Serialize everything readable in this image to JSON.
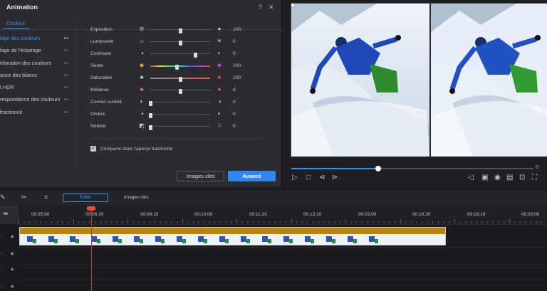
{
  "dialog": {
    "title": "Animation",
    "help_icon": "?",
    "close_icon": "✕",
    "tab": "Couleur",
    "left_items": [
      {
        "label": "lage des couleurs",
        "active": true
      },
      {
        "label": "lage de l'éclairage",
        "active": false
      },
      {
        "label": "élioration des couleurs",
        "active": false
      },
      {
        "label": "ance des blancs",
        "active": false
      },
      {
        "label": "t HDR",
        "active": false
      },
      {
        "label": "respondance des couleurs",
        "active": false
      },
      {
        "label": "fractionné",
        "active": false
      }
    ],
    "sliders": [
      {
        "label": "Exposition",
        "value": "100",
        "pos": 0.5
      },
      {
        "label": "Luminosité",
        "value": "0",
        "pos": 0.5
      },
      {
        "label": "Contraste",
        "value": "0",
        "pos": 0.75
      },
      {
        "label": "Teinte",
        "value": "100",
        "pos": 0.45
      },
      {
        "label": "Saturation",
        "value": "100",
        "pos": 0.5
      },
      {
        "label": "Brillance",
        "value": "0",
        "pos": 0.5
      },
      {
        "label": "Correct.surbrill.",
        "value": "0",
        "pos": 0.0
      },
      {
        "label": "Ombre",
        "value": "0",
        "pos": 0.0
      },
      {
        "label": "Netteté",
        "value": "0",
        "pos": 0.0
      }
    ],
    "compare_label": "Comparer dans l'aperçu fractionné",
    "compare_checked": true,
    "btn_keyframes": "Images clés",
    "btn_advanced": "Avancé"
  },
  "player": {
    "progress": 0.36,
    "time_tail": "0:"
  },
  "timeline": {
    "edit_label": "Éditer",
    "keys_label": "Images clés",
    "ticks": [
      "00;05;00",
      "00;06;20",
      "00;08;10",
      "00;10;00",
      "00;11;20",
      "00;13;10",
      "00;15;00",
      "00;16;20",
      "00;18;10",
      "00;20;00"
    ]
  },
  "colors": {
    "accent": "#2f86f0",
    "panel": "#2a2c31",
    "clip_bar": "#b8860b",
    "playhead": "#e74c3c"
  }
}
